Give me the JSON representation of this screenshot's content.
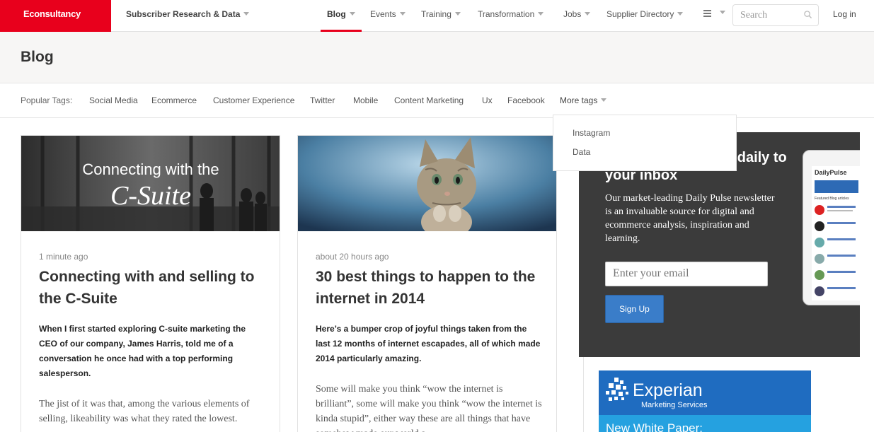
{
  "nav": {
    "logo": "Econsultancy",
    "subscriber": "Subscriber Research & Data",
    "items": [
      "Blog",
      "Events",
      "Training",
      "Transformation",
      "Jobs",
      "Supplier Directory"
    ],
    "search_placeholder": "Search",
    "login": "Log in"
  },
  "page": {
    "title": "Blog"
  },
  "tags": {
    "label": "Popular Tags:",
    "items": [
      "Social Media",
      "Ecommerce",
      "Customer Experience",
      "Twitter",
      "Mobile",
      "Content Marketing",
      "Ux",
      "Facebook"
    ],
    "more": "More tags",
    "dropdown": [
      "Instagram",
      "Data"
    ]
  },
  "articles": [
    {
      "image_text_1": "Connecting with the",
      "image_text_2": "C-Suite",
      "time": "1 minute ago",
      "title": "Connecting with and selling to the C-Suite",
      "lead": "When I first started exploring C-suite marketing the CEO of our company, James Harris, told me of a conversation he once had with a top performing salesperson.",
      "body": "The jist of it was that, among the various elements of selling, likeability was what they rated the lowest."
    },
    {
      "time": "about 20 hours ago",
      "title": "30 best things to happen to the internet in 2014",
      "lead": "Here’s a bumper crop of joyful things taken from the last 12 months of internet escapades, all of which made 2014 particularly amazing.",
      "body": "Some will make you think “wow the internet is brilliant”, some will make you think “wow the internet is kinda stupid”, either way these are all things that have somehow made our world a"
    }
  ],
  "newsletter": {
    "heading": "Get the Daily Pulse daily to your inbox",
    "text": "Our market-leading Daily Pulse newsletter is an invaluable source for digital and ecommerce analysis, inspiration and learning.",
    "email_placeholder": "Enter your email",
    "button": "Sign Up",
    "tablet_brand": "DailyPulse",
    "tablet_section": "Featured Blog articles"
  },
  "ad": {
    "brand": "Experian",
    "sub": "Marketing Services",
    "headline": "New White Paper:"
  }
}
